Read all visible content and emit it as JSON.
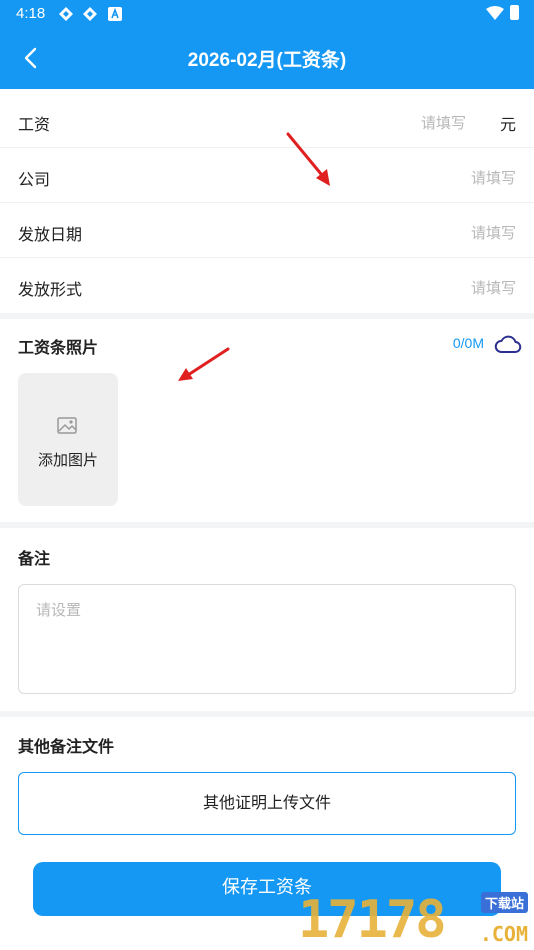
{
  "status_bar": {
    "time": "4:18"
  },
  "header": {
    "title": "2026-02月(工资条)"
  },
  "form": {
    "rows": [
      {
        "label": "工资",
        "placeholder": "请填写",
        "unit": "元"
      },
      {
        "label": "公司",
        "placeholder": "请填写"
      },
      {
        "label": "发放日期",
        "placeholder": "请填写"
      },
      {
        "label": "发放形式",
        "placeholder": "请填写"
      }
    ]
  },
  "photos": {
    "title": "工资条照片",
    "quota": "0/0M",
    "add_label": "添加图片"
  },
  "remark": {
    "title": "备注",
    "placeholder": "请设置"
  },
  "other_files": {
    "title": "其他备注文件",
    "upload_label": "其他证明上传文件"
  },
  "footer": {
    "save_label": "保存工资条"
  },
  "watermark": {
    "number": "17178",
    "site": "下载站",
    "domain": ".COM"
  },
  "colors": {
    "accent": "#1598f3",
    "annotation_arrow": "#e02020"
  }
}
